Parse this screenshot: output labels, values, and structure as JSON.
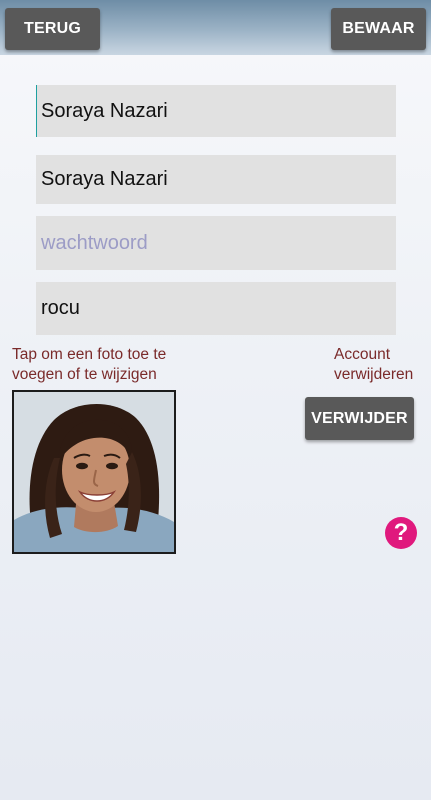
{
  "header": {
    "back_label": "TERUG",
    "save_label": "BEWAAR"
  },
  "form": {
    "full_name": "Soraya Nazari",
    "display_name": "Soraya Nazari",
    "password_placeholder": "wachtwoord",
    "username": "rocu"
  },
  "photo": {
    "hint": "Tap om een foto toe te voegen of te wijzigen"
  },
  "account": {
    "hint": "Account verwijderen",
    "delete_label": "VERWIJDER"
  },
  "help": {
    "glyph": "?",
    "color": "#e0197d"
  },
  "colors": {
    "button": "#595959",
    "hint_text": "#7a2a2a",
    "field_bg": "#e1e1e1",
    "placeholder": "#9c9cc6"
  }
}
